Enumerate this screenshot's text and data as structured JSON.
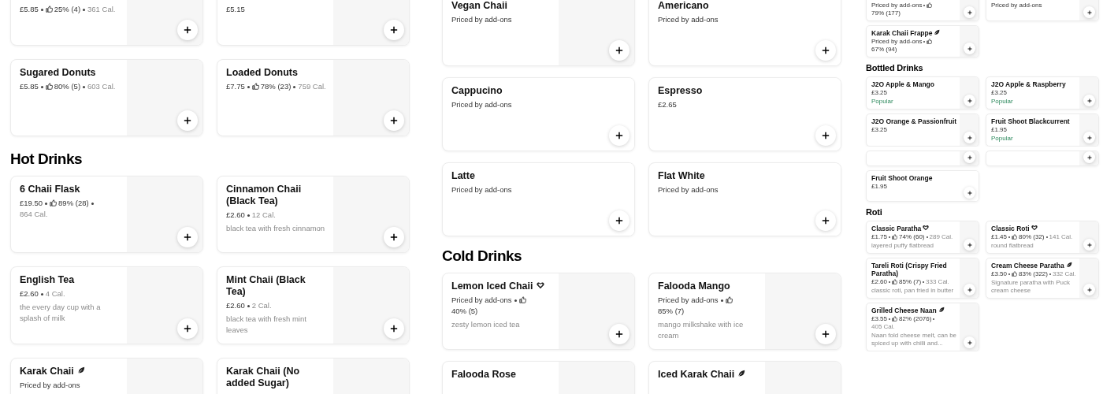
{
  "panels": [
    {
      "sections": [
        {
          "items": [
            {
              "price": "£5.85",
              "rating": "25% (4)",
              "calories": "361 Cal.",
              "image": true,
              "add_button": true
            },
            {
              "price": "£5.15",
              "image": true,
              "add_button": true
            },
            {
              "name": "Sugared Donuts",
              "price": "£5.85",
              "rating": "80% (5)",
              "calories": "603 Cal.",
              "image": true,
              "add_button": true
            },
            {
              "name": "Loaded Donuts",
              "price": "£7.75",
              "rating": "78% (23)",
              "calories": "759 Cal.",
              "image": true,
              "add_button": true
            }
          ]
        },
        {
          "heading": "Hot Drinks",
          "items": [
            {
              "name": "6 Chaii Flask",
              "price": "£19.50",
              "rating": "89% (28)",
              "calories": "864 Cal.",
              "image": true,
              "add_button": true
            },
            {
              "name": "Cinnamon Chaii (Black Tea)",
              "price": "£2.60",
              "calories": "12 Cal.",
              "description": "black tea with fresh cinnamon",
              "image": true,
              "add_button": true
            },
            {
              "name": "English Tea",
              "price": "£2.60",
              "calories": "4 Cal.",
              "description": "the every day cup with a splash of milk",
              "image": true,
              "add_button": true
            },
            {
              "name": "Mint Chaii (Black Tea)",
              "price": "£2.60",
              "calories": "2 Cal.",
              "description": "black tea with fresh mint leaves",
              "image": true,
              "add_button": true
            },
            {
              "name": "Karak Chaii",
              "leaf_icon": true,
              "price": "Priced by add-ons",
              "image": true
            },
            {
              "name": "Karak Chaii (No added Sugar)",
              "image": true
            }
          ]
        }
      ]
    },
    {
      "sections": [
        {
          "items": [
            {
              "name": "Vegan Chaii",
              "price": "Priced by add-ons",
              "image": true,
              "add_button": true
            },
            {
              "name": "Americano",
              "price": "Priced by add-ons",
              "image": false,
              "add_button": true
            },
            {
              "name": "Cappucino",
              "price": "Priced by add-ons",
              "image": false,
              "add_button": true
            },
            {
              "name": "Espresso",
              "price": "£2.65",
              "image": false,
              "add_button": true
            },
            {
              "name": "Latte",
              "price": "Priced by add-ons",
              "image": false,
              "add_button": true
            },
            {
              "name": "Flat White",
              "price": "Priced by add-ons",
              "image": false,
              "add_button": true
            }
          ]
        },
        {
          "heading": "Cold Drinks",
          "items": [
            {
              "name": "Lemon Iced Chaii",
              "heart_icon": true,
              "price": "Priced by add-ons",
              "rating": "40% (5)",
              "description": "zesty lemon iced tea",
              "image": true,
              "add_button": true
            },
            {
              "name": "Falooda Mango",
              "price": "Priced by add-ons",
              "rating": "85% (7)",
              "description": "mango milkshake with ice cream",
              "image": true,
              "add_button": true
            },
            {
              "name": "Falooda Rose",
              "image": true
            },
            {
              "name": "Iced Karak Chaii",
              "leaf_icon": true,
              "image": true
            }
          ]
        }
      ]
    },
    {
      "sections": [
        {
          "items": [
            {
              "price": "Priced by add-ons",
              "rating": "79% (177)",
              "image": true,
              "add_button": true
            },
            {
              "price": "Priced by add-ons",
              "image": true,
              "add_button": true
            },
            {
              "name": "Karak Chaii Frappe",
              "leaf_icon": true,
              "price": "Priced by add-ons",
              "rating": "67% (94)",
              "image": true,
              "add_button": true
            }
          ]
        },
        {
          "heading": "Bottled Drinks",
          "items": [
            {
              "name": "J2O Apple & Mango",
              "price": "£3.25",
              "tag": "Popular",
              "image": true,
              "add_button": true
            },
            {
              "name": "J2O Apple & Raspberry",
              "price": "£3.25",
              "tag": "Popular",
              "image": true,
              "add_button": true
            },
            {
              "name": "J2O Orange & Passionfruit",
              "price": "£3.25",
              "image": true,
              "add_button": true
            },
            {
              "name": "Fruit Shoot Blackcurrent",
              "price": "£1.95",
              "tag": "Popular",
              "image": true,
              "add_button": true
            }
          ]
        }
      ]
    },
    {
      "sections": [
        {
          "items": [
            {
              "image": true,
              "add_button": true
            },
            {
              "image": true,
              "add_button": true
            },
            {
              "name": "Fruit Shoot Orange",
              "price": "£1.95",
              "image": false,
              "add_button": true
            }
          ]
        },
        {
          "heading": "Roti",
          "items": [
            {
              "name": "Classic Paratha",
              "heart_icon": true,
              "price": "£1.75",
              "rating": "74% (60)",
              "calories": "289 Cal.",
              "description": "layered puffy flatbread",
              "image": true,
              "add_button": true
            },
            {
              "name": "Classic Roti",
              "heart_icon": true,
              "price": "£1.45",
              "rating": "80% (32)",
              "calories": "141 Cal.",
              "description": "round flatbread",
              "image": true,
              "add_button": true
            },
            {
              "name": "Tareli Roti (Crispy Fried Paratha)",
              "price": "£2.60",
              "rating": "85% (7)",
              "calories": "333 Cal.",
              "description": "classic roti, pan fried in butter",
              "image": true,
              "add_button": true
            },
            {
              "name": "Cream Cheese Paratha",
              "leaf_icon": true,
              "price": "£3.50",
              "rating": "83% (322)",
              "calories": "332 Cal.",
              "description": "Signature paratha with Puck cream cheese",
              "image": true,
              "add_button": true
            },
            {
              "name": "Grilled Cheese Naan",
              "leaf_icon": true,
              "price": "£3.55",
              "rating": "82% (2076)",
              "calories": "405 Cal.",
              "description": "Naan fold cheese melt, can be spiced up with chilli and...",
              "image": true,
              "add_button": true
            }
          ]
        }
      ]
    }
  ]
}
